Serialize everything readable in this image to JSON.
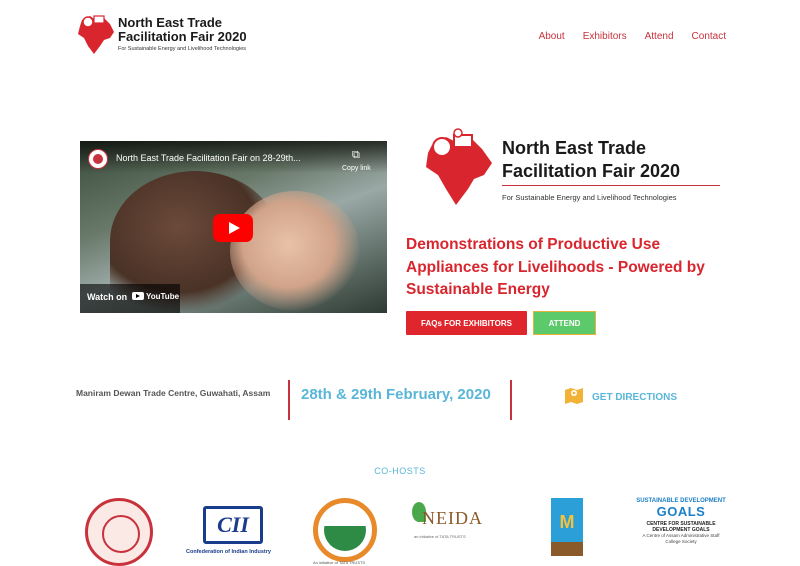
{
  "header": {
    "brand_title": "North East Trade Facilitation Fair 2020",
    "brand_subtitle": "For Sustainable Energy and Livelihood Technologies",
    "nav": [
      {
        "label": "About"
      },
      {
        "label": "Exhibitors"
      },
      {
        "label": "Attend"
      },
      {
        "label": "Contact"
      }
    ]
  },
  "video": {
    "title": "North East Trade Facilitation Fair on 28-29th...",
    "copy_label": "Copy link",
    "watch_on": "Watch on",
    "platform": "YouTube"
  },
  "hero": {
    "title": "North East Trade Facilitation Fair 2020",
    "subtitle": "For Sustainable Energy and Livelihood Technologies",
    "tagline": "Demonstrations of Productive Use Appliances for Livelihoods - Powered by Sustainable Energy",
    "faq_button": "FAQs FOR EXHIBITORS",
    "attend_button": "ATTEND"
  },
  "info": {
    "venue": "Maniram Dewan Trade Centre, Guwahati, Assam",
    "date": "28th & 29th February, 2020",
    "directions": "GET DIRECTIONS"
  },
  "cohosts": {
    "label": "CO-HOSTS",
    "cii_logo": "CII",
    "cii_text": "Confederation of Indian Industry",
    "cms_sub": "An initiative of TATA TRUSTS",
    "neida_logo": "NEIDA",
    "neida_sub": "an initiative of TATA TRUSTS",
    "sdg_line1": "SUSTAINABLE DEVELOPMENT",
    "sdg_line2": "GOALS",
    "sdg_line3": "CENTRE FOR SUSTAINABLE DEVELOPMENT GOALS",
    "sdg_line4": "A Centre of Assam Administrative Staff College Society"
  },
  "colors": {
    "accent_red": "#d9262e",
    "accent_blue": "#5ab6d8",
    "attend_green": "#5cc96a"
  }
}
